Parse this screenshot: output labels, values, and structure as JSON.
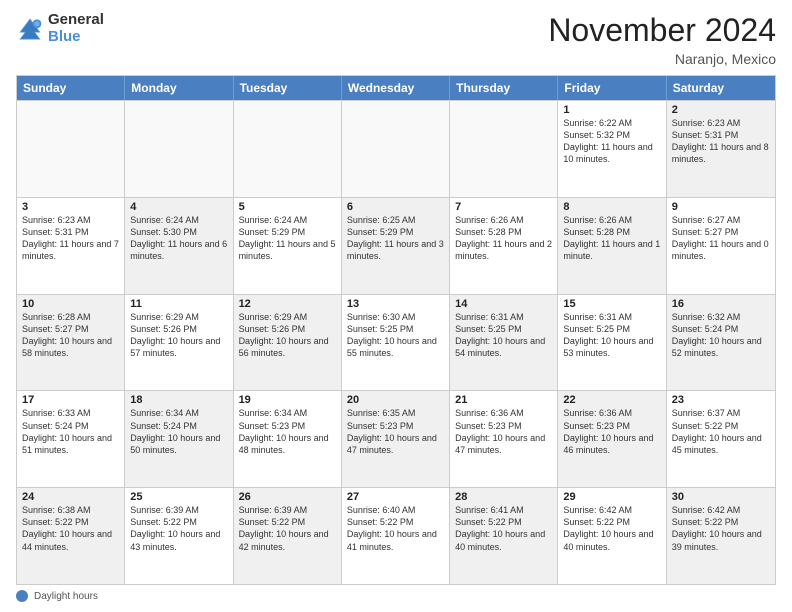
{
  "logo": {
    "general": "General",
    "blue": "Blue"
  },
  "header": {
    "month": "November 2024",
    "location": "Naranjo, Mexico"
  },
  "days": [
    "Sunday",
    "Monday",
    "Tuesday",
    "Wednesday",
    "Thursday",
    "Friday",
    "Saturday"
  ],
  "footer": {
    "label": "Daylight hours"
  },
  "weeks": [
    [
      {
        "day": "",
        "empty": true
      },
      {
        "day": "",
        "empty": true
      },
      {
        "day": "",
        "empty": true
      },
      {
        "day": "",
        "empty": true
      },
      {
        "day": "",
        "empty": true
      },
      {
        "day": "1",
        "text": "Sunrise: 6:22 AM\nSunset: 5:32 PM\nDaylight: 11 hours and 10 minutes."
      },
      {
        "day": "2",
        "shaded": true,
        "text": "Sunrise: 6:23 AM\nSunset: 5:31 PM\nDaylight: 11 hours and 8 minutes."
      }
    ],
    [
      {
        "day": "3",
        "text": "Sunrise: 6:23 AM\nSunset: 5:31 PM\nDaylight: 11 hours and 7 minutes."
      },
      {
        "day": "4",
        "shaded": true,
        "text": "Sunrise: 6:24 AM\nSunset: 5:30 PM\nDaylight: 11 hours and 6 minutes."
      },
      {
        "day": "5",
        "text": "Sunrise: 6:24 AM\nSunset: 5:29 PM\nDaylight: 11 hours and 5 minutes."
      },
      {
        "day": "6",
        "shaded": true,
        "text": "Sunrise: 6:25 AM\nSunset: 5:29 PM\nDaylight: 11 hours and 3 minutes."
      },
      {
        "day": "7",
        "text": "Sunrise: 6:26 AM\nSunset: 5:28 PM\nDaylight: 11 hours and 2 minutes."
      },
      {
        "day": "8",
        "shaded": true,
        "text": "Sunrise: 6:26 AM\nSunset: 5:28 PM\nDaylight: 11 hours and 1 minute."
      },
      {
        "day": "9",
        "text": "Sunrise: 6:27 AM\nSunset: 5:27 PM\nDaylight: 11 hours and 0 minutes."
      }
    ],
    [
      {
        "day": "10",
        "shaded": true,
        "text": "Sunrise: 6:28 AM\nSunset: 5:27 PM\nDaylight: 10 hours and 58 minutes."
      },
      {
        "day": "11",
        "text": "Sunrise: 6:29 AM\nSunset: 5:26 PM\nDaylight: 10 hours and 57 minutes."
      },
      {
        "day": "12",
        "shaded": true,
        "text": "Sunrise: 6:29 AM\nSunset: 5:26 PM\nDaylight: 10 hours and 56 minutes."
      },
      {
        "day": "13",
        "text": "Sunrise: 6:30 AM\nSunset: 5:25 PM\nDaylight: 10 hours and 55 minutes."
      },
      {
        "day": "14",
        "shaded": true,
        "text": "Sunrise: 6:31 AM\nSunset: 5:25 PM\nDaylight: 10 hours and 54 minutes."
      },
      {
        "day": "15",
        "text": "Sunrise: 6:31 AM\nSunset: 5:25 PM\nDaylight: 10 hours and 53 minutes."
      },
      {
        "day": "16",
        "shaded": true,
        "text": "Sunrise: 6:32 AM\nSunset: 5:24 PM\nDaylight: 10 hours and 52 minutes."
      }
    ],
    [
      {
        "day": "17",
        "text": "Sunrise: 6:33 AM\nSunset: 5:24 PM\nDaylight: 10 hours and 51 minutes."
      },
      {
        "day": "18",
        "shaded": true,
        "text": "Sunrise: 6:34 AM\nSunset: 5:24 PM\nDaylight: 10 hours and 50 minutes."
      },
      {
        "day": "19",
        "text": "Sunrise: 6:34 AM\nSunset: 5:23 PM\nDaylight: 10 hours and 48 minutes."
      },
      {
        "day": "20",
        "shaded": true,
        "text": "Sunrise: 6:35 AM\nSunset: 5:23 PM\nDaylight: 10 hours and 47 minutes."
      },
      {
        "day": "21",
        "text": "Sunrise: 6:36 AM\nSunset: 5:23 PM\nDaylight: 10 hours and 47 minutes."
      },
      {
        "day": "22",
        "shaded": true,
        "text": "Sunrise: 6:36 AM\nSunset: 5:23 PM\nDaylight: 10 hours and 46 minutes."
      },
      {
        "day": "23",
        "text": "Sunrise: 6:37 AM\nSunset: 5:22 PM\nDaylight: 10 hours and 45 minutes."
      }
    ],
    [
      {
        "day": "24",
        "shaded": true,
        "text": "Sunrise: 6:38 AM\nSunset: 5:22 PM\nDaylight: 10 hours and 44 minutes."
      },
      {
        "day": "25",
        "text": "Sunrise: 6:39 AM\nSunset: 5:22 PM\nDaylight: 10 hours and 43 minutes."
      },
      {
        "day": "26",
        "shaded": true,
        "text": "Sunrise: 6:39 AM\nSunset: 5:22 PM\nDaylight: 10 hours and 42 minutes."
      },
      {
        "day": "27",
        "text": "Sunrise: 6:40 AM\nSunset: 5:22 PM\nDaylight: 10 hours and 41 minutes."
      },
      {
        "day": "28",
        "shaded": true,
        "text": "Sunrise: 6:41 AM\nSunset: 5:22 PM\nDaylight: 10 hours and 40 minutes."
      },
      {
        "day": "29",
        "text": "Sunrise: 6:42 AM\nSunset: 5:22 PM\nDaylight: 10 hours and 40 minutes."
      },
      {
        "day": "30",
        "shaded": true,
        "text": "Sunrise: 6:42 AM\nSunset: 5:22 PM\nDaylight: 10 hours and 39 minutes."
      }
    ]
  ]
}
